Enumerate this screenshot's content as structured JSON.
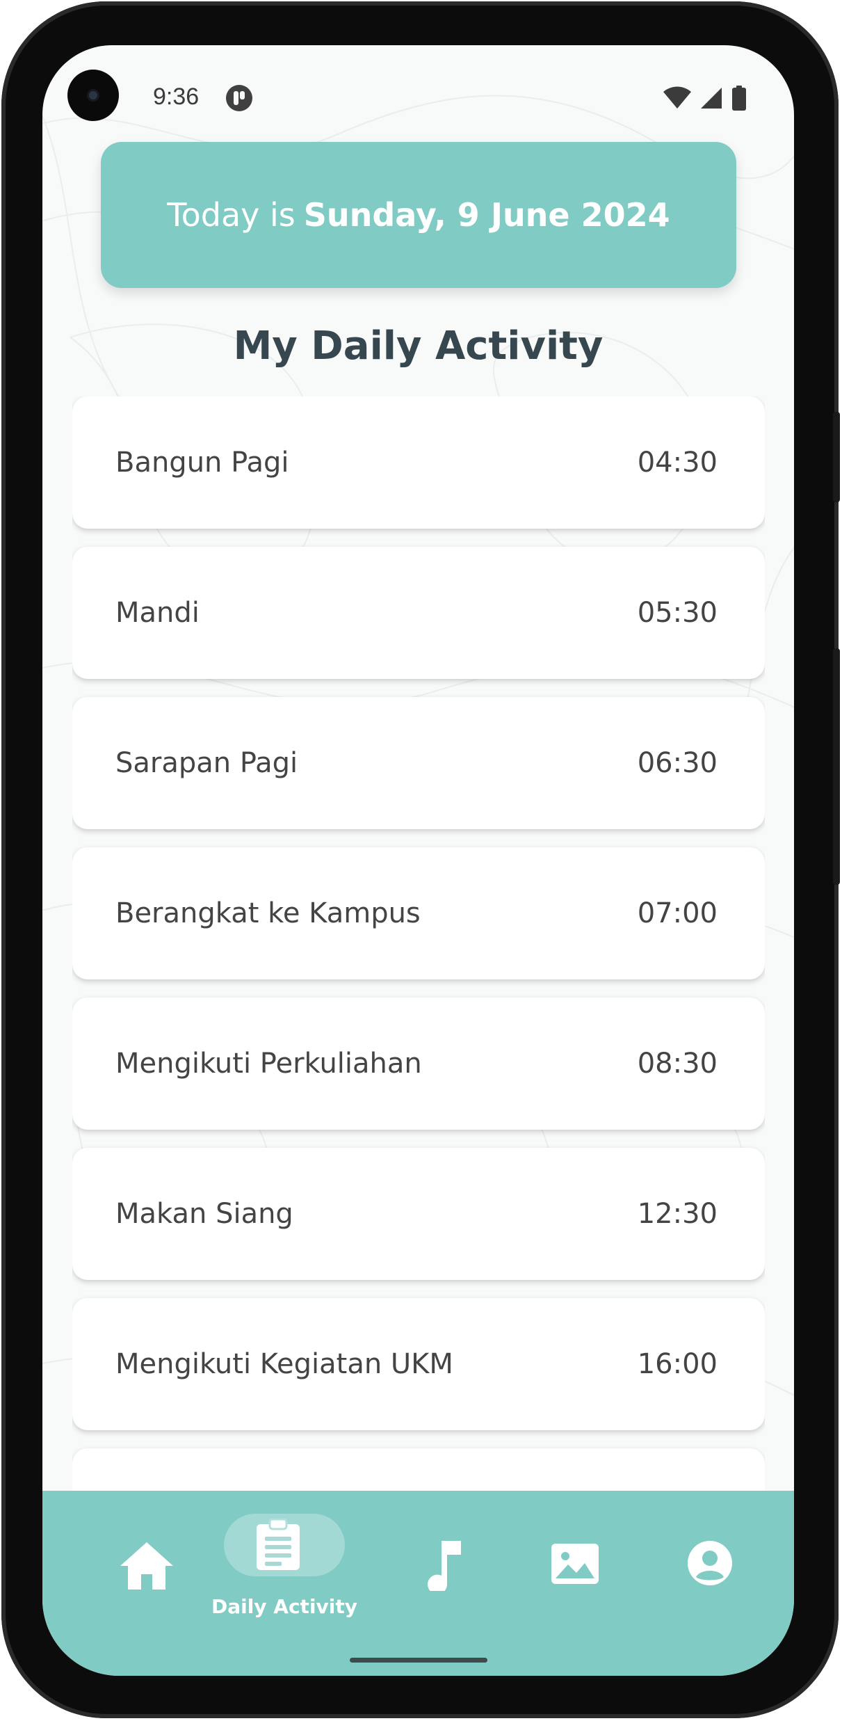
{
  "status_bar": {
    "time": "9:36",
    "app_icon": "notification-app-icon",
    "icons": [
      "wifi-icon",
      "cellular-signal-icon",
      "battery-icon"
    ]
  },
  "banner": {
    "prefix": "Today is",
    "date": "Sunday, 9 June 2024",
    "background_color": "#80cbc4"
  },
  "page_title": "My Daily Activity",
  "activities": [
    {
      "name": "Bangun Pagi",
      "time": "04:30"
    },
    {
      "name": "Mandi",
      "time": "05:30"
    },
    {
      "name": "Sarapan Pagi",
      "time": "06:30"
    },
    {
      "name": "Berangkat ke Kampus",
      "time": "07:00"
    },
    {
      "name": "Mengikuti Perkuliahan",
      "time": "08:30"
    },
    {
      "name": "Makan Siang",
      "time": "12:30"
    },
    {
      "name": "Mengikuti Kegiatan UKM",
      "time": "16:00"
    },
    {
      "name": "",
      "time": ""
    }
  ],
  "bottom_nav": {
    "background_color": "#80cbc4",
    "items": [
      {
        "icon": "home-icon",
        "label": "",
        "active": false
      },
      {
        "icon": "clipboard-icon",
        "label": "Daily Activity",
        "active": true
      },
      {
        "icon": "music-note-icon",
        "label": "",
        "active": false
      },
      {
        "icon": "image-icon",
        "label": "",
        "active": false
      },
      {
        "icon": "account-circle-icon",
        "label": "",
        "active": false
      }
    ]
  }
}
